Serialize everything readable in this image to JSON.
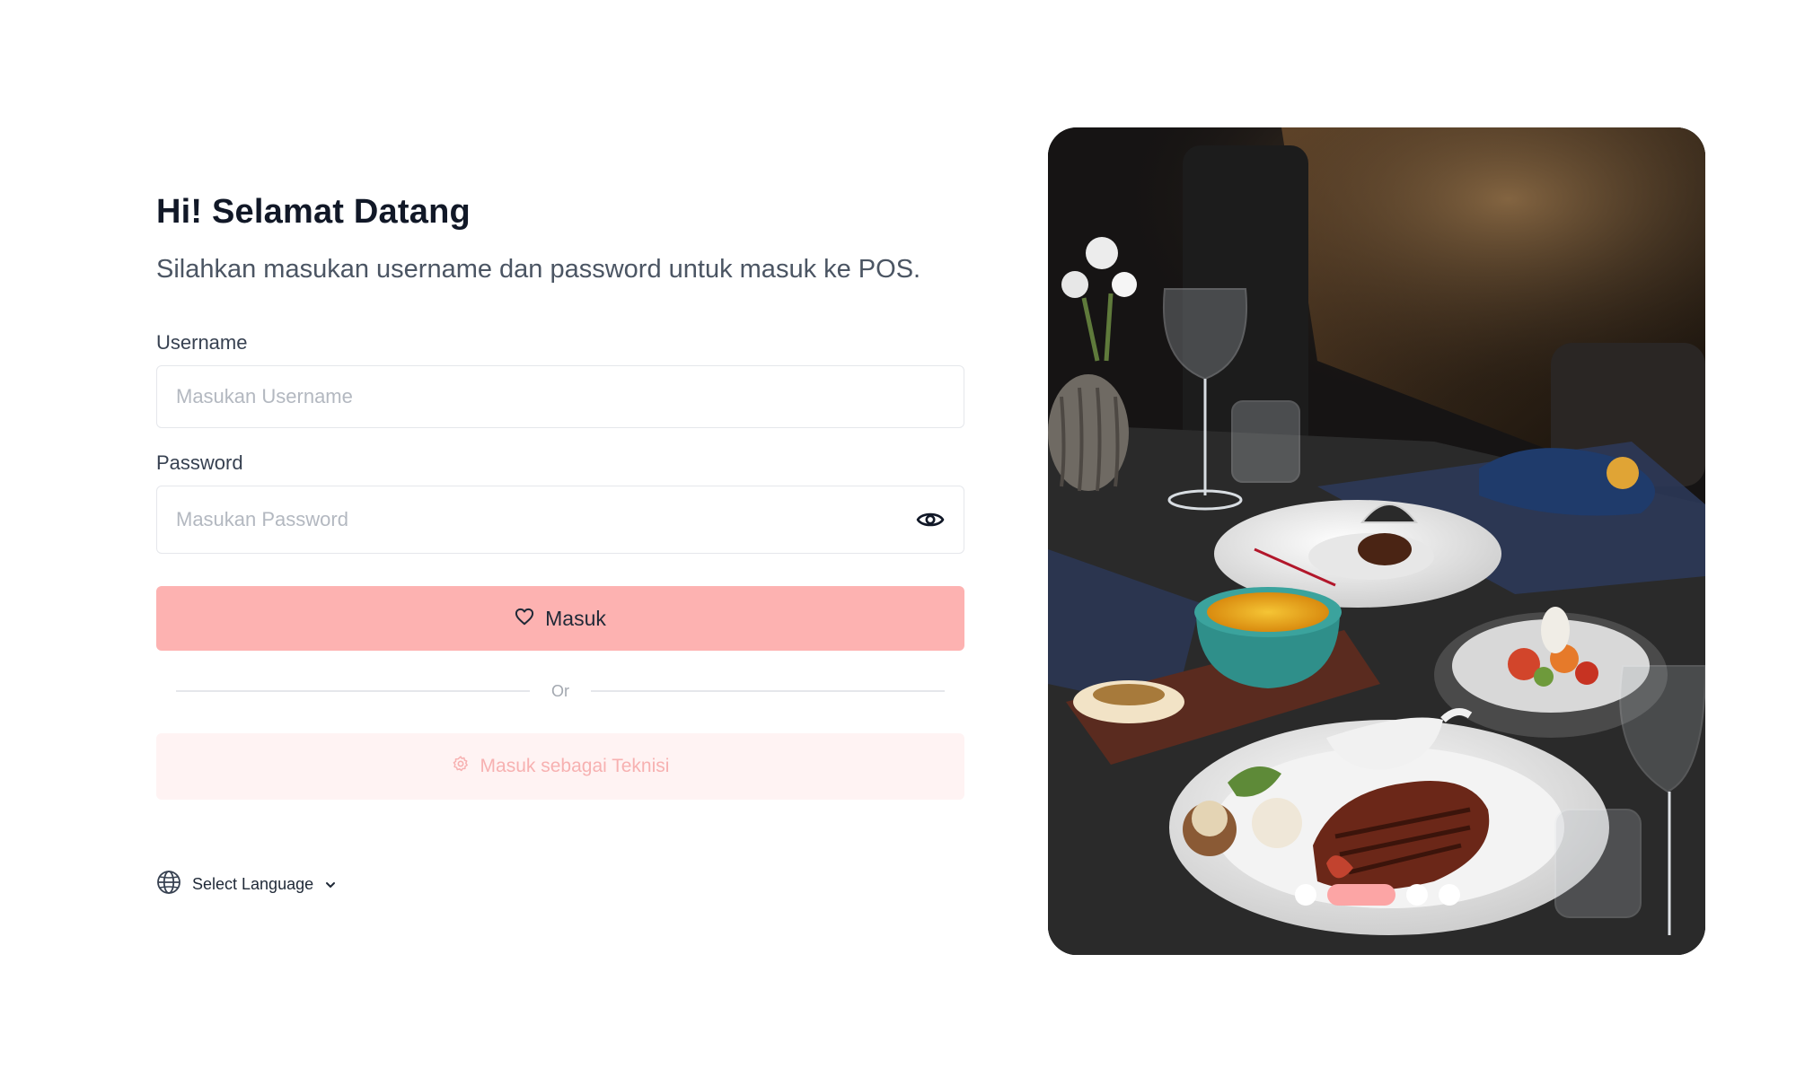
{
  "header": {
    "title": "Hi! Selamat Datang",
    "subtitle": "Silahkan masukan username dan password untuk masuk ke POS."
  },
  "form": {
    "username_label": "Username",
    "username_placeholder": "Masukan Username",
    "username_value": "",
    "password_label": "Password",
    "password_placeholder": "Masukan Password",
    "password_value": "",
    "login_label": "Masuk",
    "divider_label": "Or",
    "technician_label": "Masuk sebagai Teknisi"
  },
  "language": {
    "label": "Select Language"
  },
  "icons": {
    "password_toggle": "eye-icon",
    "login": "heart-icon",
    "technician": "gear-icon",
    "language": "globe-icon",
    "language_dropdown": "chevron-down-icon"
  },
  "carousel": {
    "slide_count": 4,
    "active_index": 1,
    "image_subject": "restaurant table with plated dishes"
  },
  "colors": {
    "primary_button": "#fdb2b1",
    "secondary_button_bg": "#fff3f3",
    "secondary_button_text": "#f7b1b1",
    "active_dot": "#fca5a5",
    "title_text": "#111827"
  }
}
